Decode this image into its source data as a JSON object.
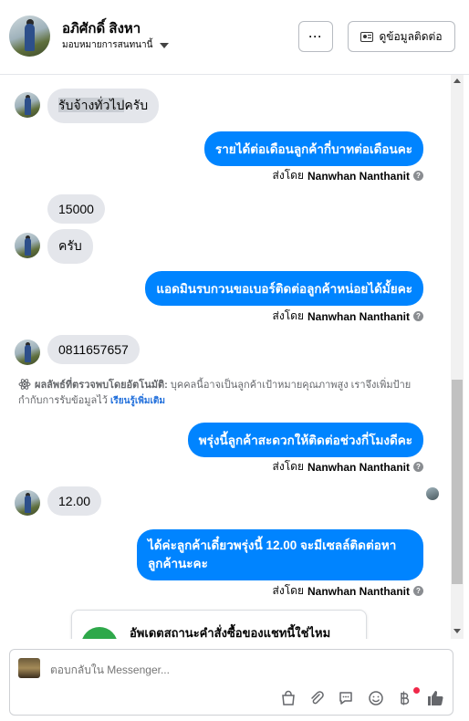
{
  "header": {
    "contact_name": "อภิศักดิ์ สิงหา",
    "assign_label": "มอบหมายการสนทนานี้",
    "more_label": "···",
    "contact_info_label": "ดูข้อมูลติดต่อ"
  },
  "messages": {
    "m1_pre": "รับจ้างทั่วไป",
    "m1_post": "ครับ",
    "m2": "รายได้ต่อเดือนลูกค้ากี่บาทต่อเดือนคะ",
    "m3": "15000",
    "m4": "ครับ",
    "m5": "แอดมินรบกวนขอเบอร์ติดต่อลูกค้าหน่อยได้มั้ยคะ",
    "m6": "0811657657",
    "m7": "พรุ่งนี้ลูกค้าสะดวกให้ติดต่อช่วงกี่โมงดีคะ",
    "m8": "12.00",
    "m9": "ได้ค่ะลูกค้าเดี๋ยวพรุ่งนี้ 12.00 จะมีเซลล์ติดต่อหาลูกค้านะคะ"
  },
  "sent_by": {
    "prefix": "ส่งโดย",
    "name": "Nanwhan Nanthanit",
    "help": "?"
  },
  "auto_note": {
    "lead": "ผลลัพธ์ที่ตรวจพบโดยอัตโนมัติ:",
    "text": " บุคคลนี้อาจเป็นลูกค้าเป้าหมายคุณภาพสูง เราจึงเพิ่มป้ายกำกับการรับข้อมูลไว้ ",
    "link": "เรียนรู้เพิ่มเติม"
  },
  "status_card": {
    "title": "อัพเดตสถานะคำสั่งซื้อของแชทนี้ใช่ไหม"
  },
  "composer": {
    "placeholder": "ตอบกลับใน Messenger..."
  },
  "icons": [
    "ellipsis-icon",
    "contact-card-icon",
    "help-icon",
    "bag-icon",
    "paperclip-icon",
    "chat-bubble-icon",
    "emoji-icon",
    "baht-icon",
    "thumbs-up-icon",
    "atom-icon"
  ],
  "colors": {
    "outgoing_bubble": "#0084ff",
    "incoming_bubble": "#e4e6eb",
    "link": "#216fdb",
    "status_green": "#2ea84a"
  }
}
